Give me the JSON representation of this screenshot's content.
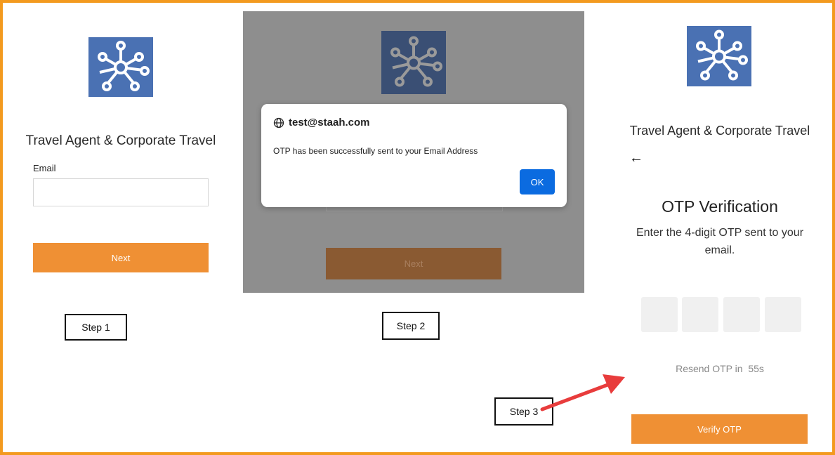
{
  "brand": {
    "logo_icon": "network-hub-icon",
    "logo_color": "#4a71b3",
    "accent": "#ef9034",
    "frame_color": "#f39a1f"
  },
  "step1": {
    "title": "Travel Agent & Corporate Travel",
    "email_label": "Email",
    "email_value": "",
    "next_label": "Next",
    "step_label": "Step 1"
  },
  "step2": {
    "dialog_host": "test@staah.com",
    "dialog_message": "OTP has been successfully sent to your Email Address",
    "ok_label": "OK",
    "next_label": "Next",
    "step_label": "Step 2"
  },
  "step3": {
    "title": "Travel Agent & Corporate Travel",
    "back_icon": "arrow-left-icon",
    "heading": "OTP Verification",
    "subtitle": "Enter the 4-digit OTP sent to your email.",
    "otp_digits": [
      "",
      "",
      "",
      ""
    ],
    "resend_text": "Resend OTP in",
    "resend_countdown": "55s",
    "verify_label": "Verify OTP",
    "step_label": "Step 3"
  }
}
